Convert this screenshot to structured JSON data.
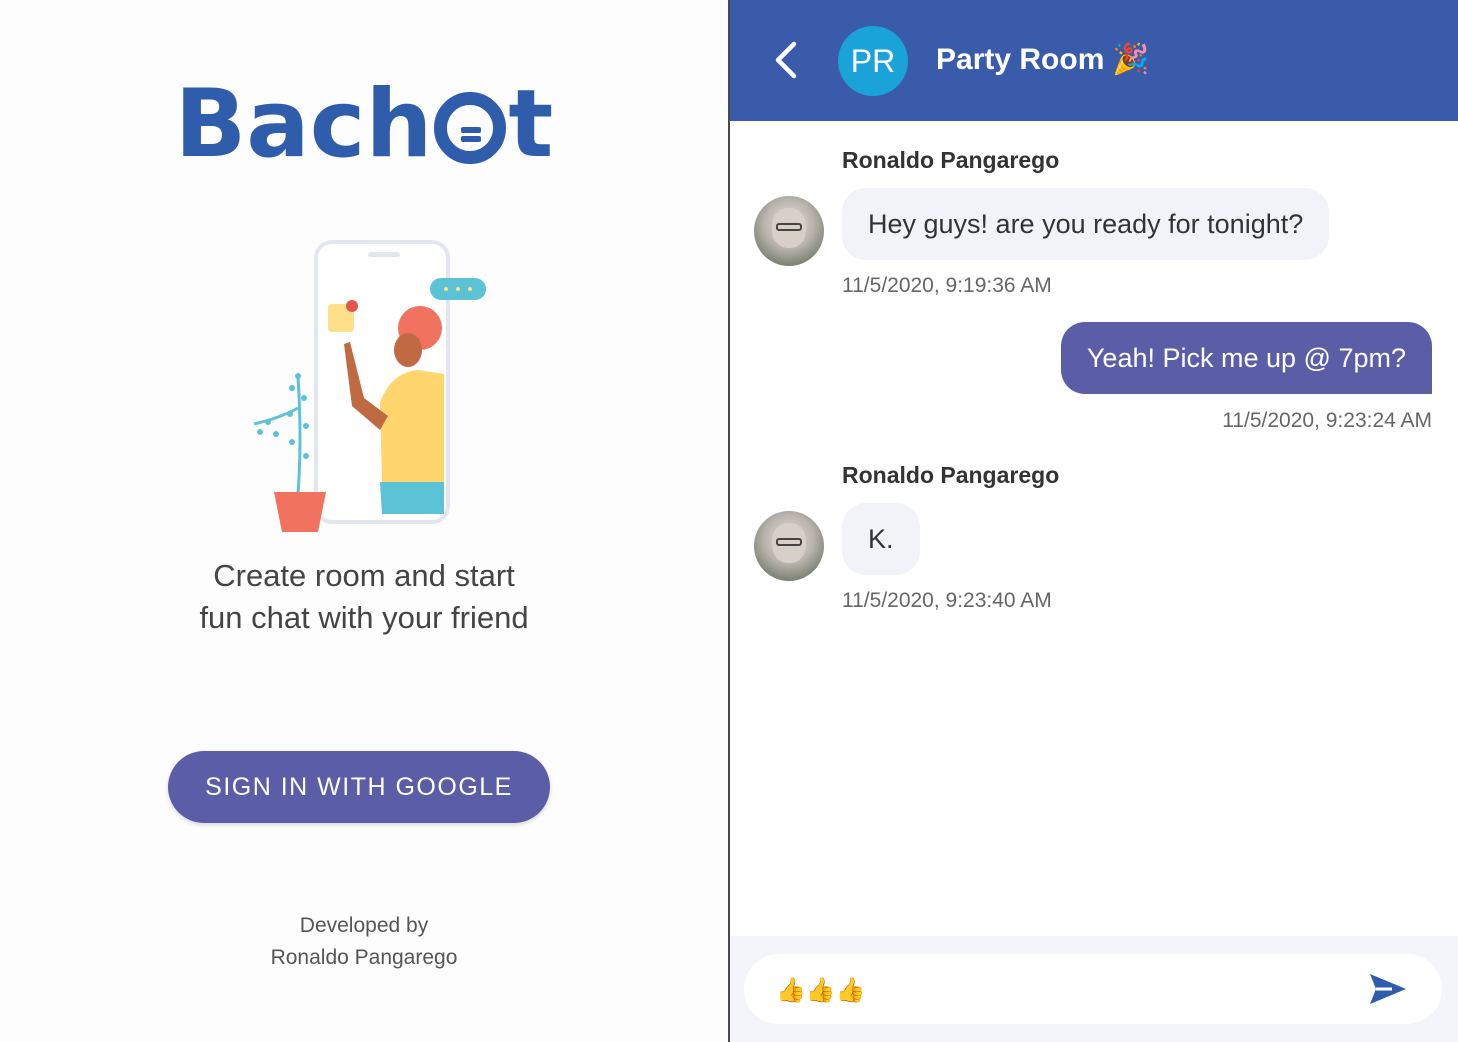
{
  "left": {
    "brand": {
      "part1": "Bach",
      "part2": "t"
    },
    "tagline": {
      "line1": "Create room and start",
      "line2": "fun chat with your friend"
    },
    "sign_in_label": "SIGN IN WITH GOOGLE",
    "developer": {
      "line1": "Developed by",
      "line2": "Ronaldo Pangarego"
    }
  },
  "chat": {
    "room": {
      "initials": "PR",
      "title": "Party Room",
      "emoji": "🎉"
    },
    "messages": [
      {
        "sender": "Ronaldo Pangarego",
        "text": "Hey guys! are you ready for tonight?",
        "time": "11/5/2020, 9:19:36 AM",
        "direction": "incoming"
      },
      {
        "text": "Yeah! Pick me up @ 7pm?",
        "time": "11/5/2020, 9:23:24 AM",
        "direction": "outgoing"
      },
      {
        "sender": "Ronaldo Pangarego",
        "text": "K.",
        "time": "11/5/2020, 9:23:40 AM",
        "direction": "incoming"
      }
    ],
    "composer": {
      "value": "👍👍👍"
    }
  },
  "colors": {
    "brand_blue": "#2f5cab",
    "header_blue": "#3a5ba9",
    "accent_purple": "#5b5ea6",
    "room_avatar": "#1aa3d8"
  },
  "icons": [
    "back-arrow-icon",
    "send-icon",
    "chat-bubble-logo-icon"
  ]
}
